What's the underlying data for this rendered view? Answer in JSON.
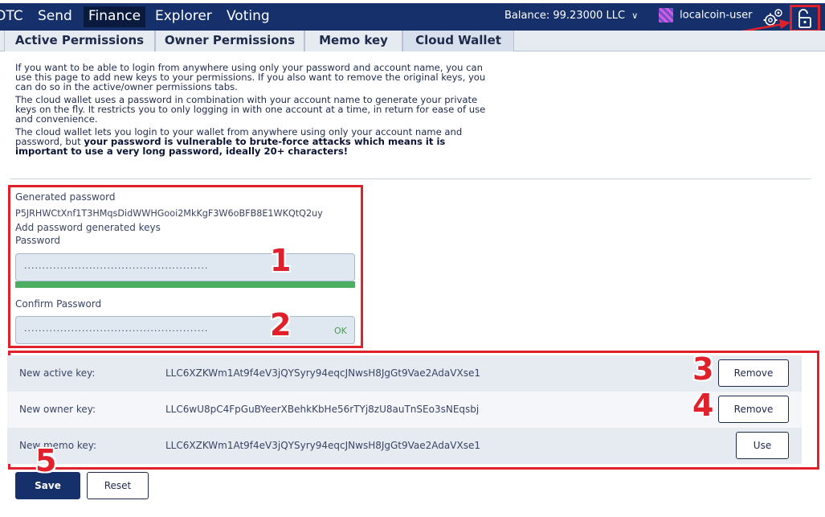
{
  "nav": {
    "items": [
      "OTC",
      "Send",
      "Finance",
      "Explorer",
      "Voting"
    ],
    "active": "Finance",
    "balance_label": "Balance:",
    "balance_value": "99.23000 LLC",
    "username": "localcoin-user"
  },
  "tabs": [
    {
      "label": "Active Permissions"
    },
    {
      "label": "Owner Permissions"
    },
    {
      "label": "Memo key"
    },
    {
      "label": "Cloud Wallet"
    }
  ],
  "intro": {
    "p1": "If you want to be able to login from anywhere using only your password and account name, you can use this page to add new keys to your permissions. If you also want to remove the original keys, you can do so in the active/owner permissions tabs.",
    "p2": "The cloud wallet uses a password in combination with your account name to generate your private keys on the fly. It restricts you to only logging in with one account at a time, in return for ease of use and convenience.",
    "p3_normal": "The cloud wallet lets you login to your wallet from anywhere using only your account name and password, but ",
    "p3_bold": "your password is vulnerable to brute-force attacks which means it is important to use a very long password, ideally 20+ characters!"
  },
  "password": {
    "generated_label": "Generated password",
    "generated_value": "P5JRHWCtXnf1T3HMqsDidWWHGooi2MkKgF3W6oBFB8E1WKQtQ2uy",
    "add_label": "Add password generated keys",
    "password_label": "Password",
    "password_mask": "...................................................",
    "strength_fraction": 1.0,
    "confirm_label": "Confirm Password",
    "confirm_mask": "...................................................",
    "confirm_status": "OK"
  },
  "keys": [
    {
      "label": "New active key:",
      "value": "LLC6XZKWm1At9f4eV3jQYSyry94eqcJNwsH8JgGt9Vae2AdaVXse1",
      "button": "Remove"
    },
    {
      "label": "New owner key:",
      "value": "LLC6wU8pC4FpGuBYeerXBehkKbHe56rTYj8zU8auTnSEo3sNEqsbj",
      "button": "Remove"
    },
    {
      "label": "New memo key:",
      "value": "LLC6XZKWm1At9f4eV3jQYSyry94eqcJNwsH8JgGt9Vae2AdaVXse1",
      "button": "Use"
    }
  ],
  "actions": {
    "save": "Save",
    "reset": "Reset"
  },
  "annotations": [
    "1",
    "2",
    "3",
    "4",
    "5"
  ],
  "colors": {
    "nav_bg": "#15306b",
    "highlight": "#e0202a",
    "strength": "#4cae60",
    "ok": "#4a9a55"
  }
}
